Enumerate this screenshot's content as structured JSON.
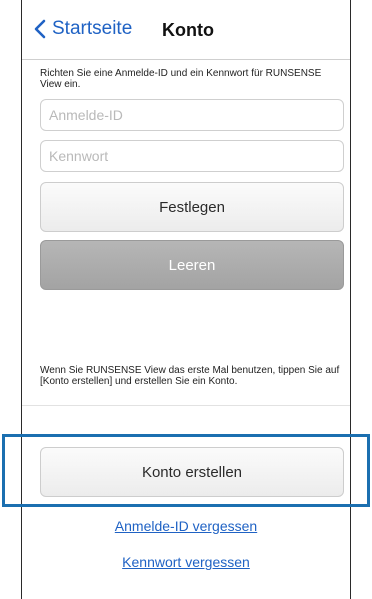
{
  "nav": {
    "back_label": "Startseite",
    "title": "Konto"
  },
  "form": {
    "instruction": "Richten Sie eine Anmelde-ID und ein Kennwort für RUNSENSE View ein.",
    "id_placeholder": "Anmelde-ID",
    "password_placeholder": "Kennwort",
    "set_button": "Festlegen",
    "clear_button": "Leeren"
  },
  "account": {
    "info": "Wenn Sie RUNSENSE View das erste Mal benutzen, tippen Sie auf [Konto erstellen] und erstellen Sie ein Konto.",
    "create_button": "Konto erstellen",
    "forgot_id_link": "Anmelde-ID vergessen",
    "forgot_password_link": "Kennwort vergessen"
  },
  "colors": {
    "link_blue": "#1f62c4",
    "highlight_border": "#1b6fb0",
    "clear_button_gray": "#a8a8a8"
  },
  "icons": {
    "back": "chevron-left-icon"
  }
}
